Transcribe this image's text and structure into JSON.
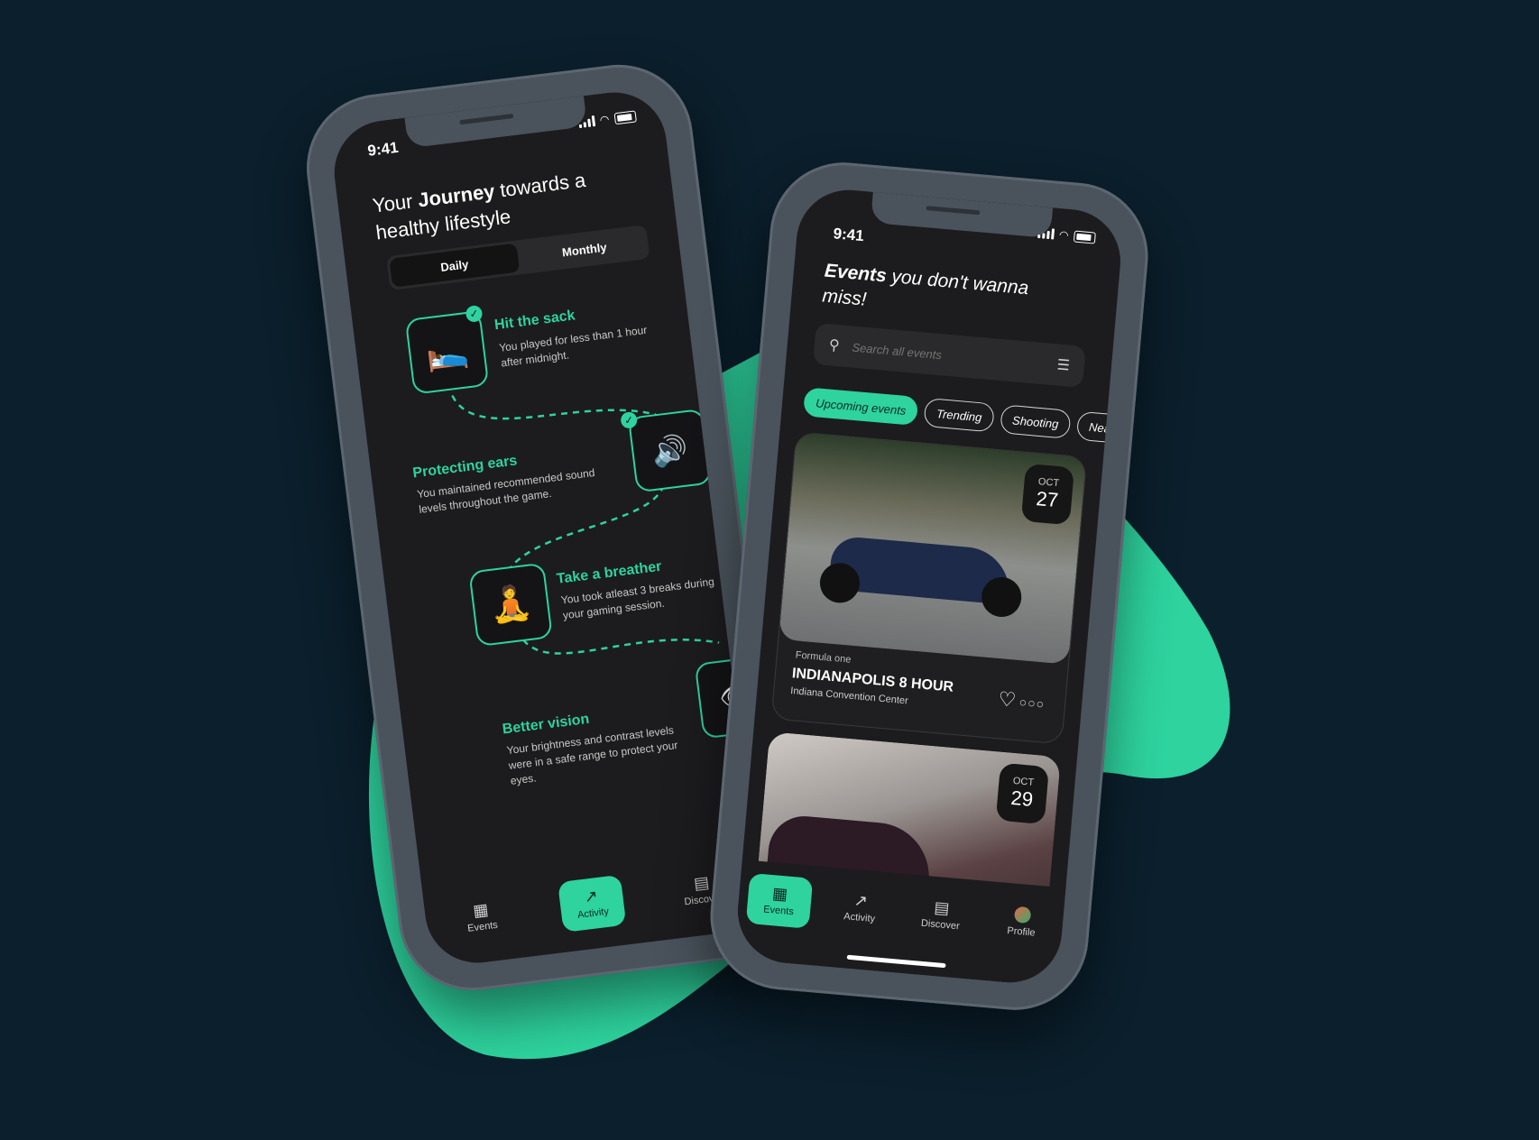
{
  "colors": {
    "background": "#0b1f2c",
    "accent": "#2ed39e",
    "phone_frame": "#4a535c",
    "screen": "#1c1c1e"
  },
  "left_phone": {
    "time": "9:41",
    "title_pre": "Your ",
    "title_bold": "Journey",
    "title_post": " towards a healthy lifestyle",
    "segments": {
      "daily": "Daily",
      "monthly": "Monthly",
      "selected": "Daily"
    },
    "tasks": [
      {
        "title": "Hit the sack",
        "desc": "You played for less than 1 hour after midnight.",
        "icon": "sleeping-person",
        "done": true
      },
      {
        "title": "Protecting ears",
        "desc": "You maintained recommended sound levels throughout the game.",
        "icon": "sound-level",
        "done": true
      },
      {
        "title": "Take a breather",
        "desc": "You took atleast 3 breaks during your gaming session.",
        "icon": "meditating-gamer",
        "done": false
      },
      {
        "title": "Better vision",
        "desc": "Your brightness and contrast levels were in a safe range to protect your eyes.",
        "icon": "eye",
        "done": false
      }
    ],
    "tabs": {
      "events": "Events",
      "activity": "Activity",
      "discover": "Discover",
      "selected": "Activity"
    }
  },
  "right_phone": {
    "time": "9:41",
    "title_bold": "Events",
    "title_post": " you don't wanna miss!",
    "search_placeholder": "Search all events",
    "chips": [
      "Upcoming events",
      "Trending",
      "Shooting",
      "Near"
    ],
    "selected_chip": "Upcoming events",
    "events": [
      {
        "category": "Formula one",
        "name": "INDIANAPOLIS 8 HOUR",
        "venue": "Indiana Convention Center",
        "month": "OCT",
        "day": "27"
      },
      {
        "month": "OCT",
        "day": "29"
      }
    ],
    "tabs": {
      "events": "Events",
      "activity": "Activity",
      "discover": "Discover",
      "profile": "Profile",
      "selected": "Events"
    }
  }
}
